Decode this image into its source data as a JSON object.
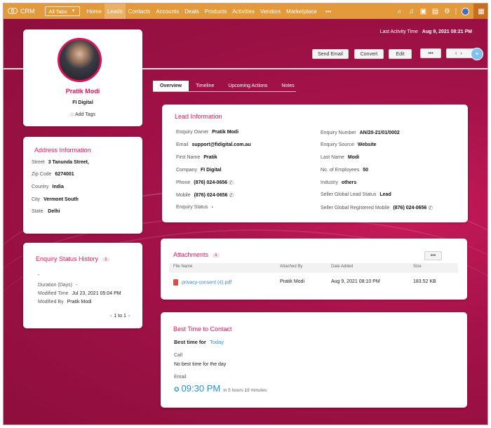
{
  "topnav": {
    "brand": "CRM",
    "all_tabs_label": "All Tabs",
    "tabs": [
      "Home",
      "Leads",
      "Contacts",
      "Accounts",
      "Deals",
      "Products",
      "Activities",
      "Vendors",
      "Marketplace"
    ],
    "more_label": "•••",
    "active_tab": "Leads",
    "accent": "#e39a3b"
  },
  "header": {
    "last_activity_label": "Last Activity Time",
    "last_activity_value": "Aug 9, 2021 08:21 PM",
    "send_email_label": "Send Email",
    "convert_label": "Convert",
    "edit_label": "Edit",
    "more_label": "•••"
  },
  "profile": {
    "name": "Pratik Modi",
    "company": "FI Digital",
    "add_tags_label": "Add Tags"
  },
  "address": {
    "title": "Address Information",
    "street_label": "Street",
    "street": "3 Tanunda Street,",
    "zip_label": "Zip Code",
    "zip": "6274001",
    "country_label": "Country",
    "country": "India",
    "city_label": "City",
    "city": "Vermont South",
    "state_label": "State.",
    "state": "Delhi"
  },
  "enquiry_history": {
    "title": "Enquiry Status History",
    "count": "1",
    "status": "-",
    "duration_label": "Duration (Days)",
    "duration": "-",
    "modified_time_label": "Modified Time",
    "modified_time": "Jul 23, 2021 05:04 PM",
    "modified_by_label": "Modified By",
    "modified_by": "Pratik Modi",
    "pager": "1 to 1"
  },
  "detail_tabs": [
    "Overview",
    "Timeline",
    "Upcoming Actions",
    "Notes"
  ],
  "lead_info": {
    "title": "Lead Information",
    "enquiry_owner_label": "Enquiry Owner",
    "enquiry_owner": "Pratik Modi",
    "email_label": "Email",
    "email": "support@fidigital.com.au",
    "first_name_label": "First Name",
    "first_name": "Pratik",
    "company_label": "Company",
    "company": "FI Digital",
    "phone_label": "Phone",
    "phone": "(876) 024-0656",
    "mobile_label": "Mobile",
    "mobile": "(876) 024-0656",
    "enquiry_status_label": "Enquiry Status",
    "enquiry_status": "-",
    "enquiry_number_label": "Enquiry Number",
    "enquiry_number": "AN/20-21/01/0002",
    "enquiry_source_label": "Enquiry Source",
    "enquiry_source": "Website",
    "last_name_label": "Last Name",
    "last_name": "Modi",
    "employees_label": "No. of Employees",
    "employees": "50",
    "industry_label": "Industry",
    "industry": "others",
    "seller_status_label": "Seller Global Lead Status",
    "seller_status": "Lead",
    "seller_mobile_label": "Seller Global Registered Mobile",
    "seller_mobile": "(876) 024-0656"
  },
  "attachments": {
    "title": "Attachments",
    "count": "1",
    "more_label": "•••",
    "columns": [
      "File Name",
      "Attached By",
      "Date Added",
      "Size"
    ],
    "rows": [
      {
        "file": "privacy-consent (4).pdf",
        "by": "Pratik Modi",
        "date": "Aug 9, 2021 08:10 PM",
        "size": "183.52 KB"
      }
    ]
  },
  "best_time": {
    "title": "Best Time to Contact",
    "heading": "Best time for",
    "period": "Today",
    "call_label": "Call",
    "call_value": "No best time for the day",
    "email_label": "Email",
    "email_time": "09:30 PM",
    "email_note": "in 5 hours 19 minutes"
  },
  "colors": {
    "brand_pink": "#d4175a",
    "hero_bg": "#a41249",
    "link_blue": "#2b8fd8"
  }
}
